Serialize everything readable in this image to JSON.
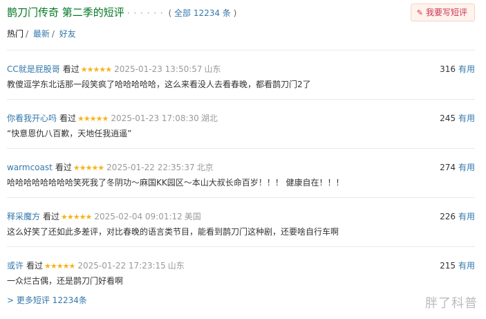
{
  "header": {
    "title": "鹊刀门传奇 第二季的短评",
    "dots": "· · · · · ·",
    "count_prefix": "( ",
    "count_text": "全部 12234 条",
    "count_suffix": " )",
    "write_button": "我要写短评"
  },
  "tabs": [
    {
      "label": "热门"
    },
    {
      "label": "最新"
    },
    {
      "label": "好友"
    }
  ],
  "tab_sep": "/",
  "seen_label": "看过",
  "useful_label": "有用",
  "stars_glyph": "★★★★★",
  "comments": [
    {
      "user": "CC就是屁股哥",
      "rating": 5,
      "time": "2025-01-23 13:50:57",
      "location": "山东",
      "votes": "316",
      "text": "教傻逗学东北话那一段笑疯了哈哈哈哈哈，这么来看没人去看春晚，都看鹊刀门2了"
    },
    {
      "user": "你看我开心吗",
      "rating": 5,
      "time": "2025-01-23 17:08:30",
      "location": "湖北",
      "votes": "245",
      "text": "“快意恩仇八百歉，天地任我逍遥”"
    },
    {
      "user": "warmcoast",
      "rating": 5,
      "time": "2025-01-22 22:35:37",
      "location": "北京",
      "votes": "274",
      "text": "哈哈哈哈哈哈哈哈笑死我了冬阴功～麻国KK园区～本山大叔长命百岁！！！ 健康自在！！！"
    },
    {
      "user": "释采魔方",
      "rating": 5,
      "time": "2025-02-04 09:01:12",
      "location": "美国",
      "votes": "226",
      "text": "这么好笑了还如此多差评，对比春晚的语言类节目，能看到鹊刀门这种剧，还要啥自行车啊"
    },
    {
      "user": "或许",
      "rating": 5,
      "time": "2025-01-22 17:23:15",
      "location": "山东",
      "votes": "215",
      "text": "一众烂古偶，还是鹊刀门好看啊"
    }
  ],
  "more_link": "> 更多短评 12234条",
  "watermark": "胖了科普",
  "colors": {
    "link": "#3377aa",
    "title": "#007722",
    "star": "#f5b41e",
    "button_bg": "#fff3ec",
    "button_text": "#cc3355"
  }
}
